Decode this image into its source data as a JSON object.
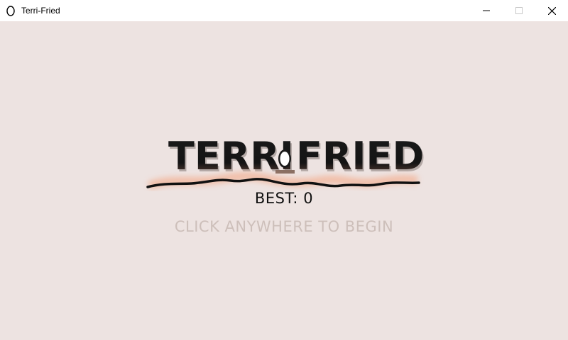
{
  "window": {
    "title": "Terri-Fried",
    "icon": "egg-icon",
    "controls": [
      "minimize-icon",
      "maximize-icon",
      "close-icon"
    ]
  },
  "game": {
    "logo_left": "TERRI",
    "logo_right": "FRIED",
    "logo_icon": "egg-on-platform-icon",
    "best_label": "BEST:",
    "best_value": "0",
    "prompt": "CLICK ANYWHERE TO BEGIN",
    "colors": {
      "background": "#ede3e1",
      "text_dark": "#111111",
      "prompt_text": "#cdbfba",
      "lava_glow": "#f4a07a",
      "platform": "#8a6f63"
    }
  }
}
